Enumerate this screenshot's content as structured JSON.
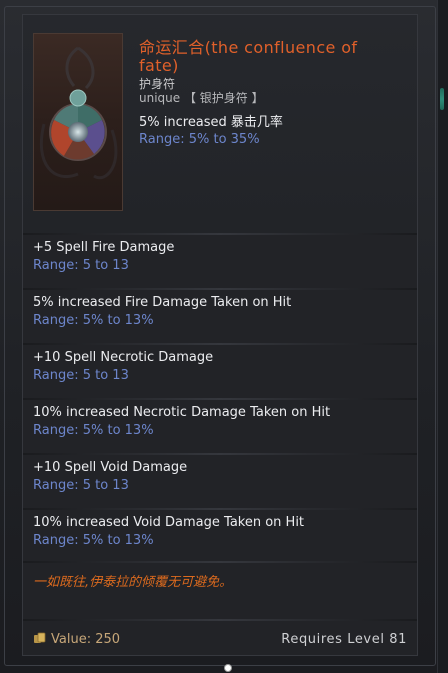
{
  "item": {
    "name": "命运汇合(the confluence of fate)",
    "type": "护身符",
    "rarity": "unique 【 银护身符 】",
    "implicit": "5% increased 暴击几率",
    "implicit_range": "Range: 5% to 35%"
  },
  "affixes": [
    {
      "text": "+5 Spell Fire Damage",
      "range": "Range: 5 to 13"
    },
    {
      "text": "5% increased Fire Damage Taken on Hit",
      "range": "Range: 5% to 13%"
    },
    {
      "text": "+10 Spell Necrotic Damage",
      "range": "Range: 5 to 13"
    },
    {
      "text": "10% increased Necrotic Damage Taken on Hit",
      "range": "Range: 5% to 13%"
    },
    {
      "text": "+10 Spell Void Damage",
      "range": "Range: 5 to 13"
    },
    {
      "text": "10% increased Void Damage Taken on Hit",
      "range": "Range: 5% to 13%"
    }
  ],
  "flavor": "一如既往,伊泰拉的倾覆无可避免。",
  "footer": {
    "value_label": "Value: 250",
    "requirement": "Requires Level 81"
  },
  "icons": {
    "item": "amulet-icon",
    "currency": "gold-coin-icon"
  },
  "colors": {
    "unique_title": "#e0602a",
    "range": "#6d86cc",
    "flavor": "#dc6a1e",
    "value": "#c7a779"
  }
}
